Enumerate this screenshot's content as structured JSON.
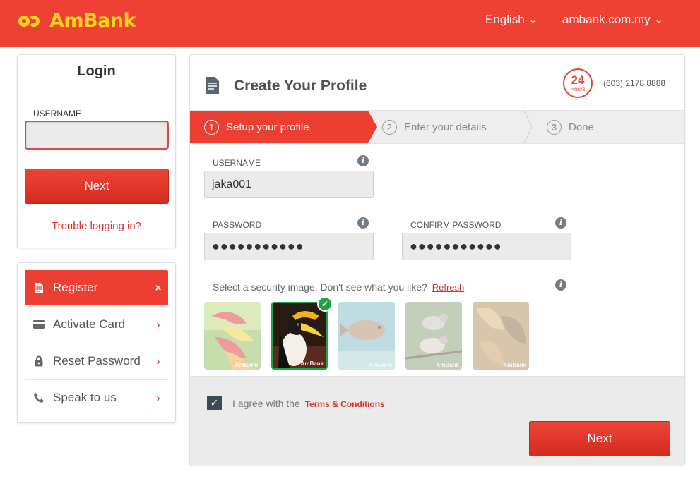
{
  "header": {
    "brand": "AmBank",
    "language": "English",
    "site": "ambank.com.my"
  },
  "login": {
    "title": "Login",
    "username_label": "USERNAME",
    "username_value": "",
    "next_label": "Next",
    "trouble_label": "Trouble logging in?"
  },
  "menu": {
    "items": [
      {
        "label": "Register",
        "icon": "document-icon",
        "action": "×",
        "active": true
      },
      {
        "label": "Activate Card",
        "icon": "card-icon",
        "action": "›",
        "active": false
      },
      {
        "label": "Reset Password",
        "icon": "lock-icon",
        "action": "›",
        "active": false
      },
      {
        "label": "Speak to us",
        "icon": "phone-icon",
        "action": "›",
        "active": false
      }
    ]
  },
  "profile": {
    "title": "Create Your Profile",
    "hotline_badge": {
      "number": "24",
      "text": "Hours"
    },
    "phone": "(603) 2178 8888",
    "steps": [
      {
        "num": "1",
        "label": "Setup your profile",
        "active": true
      },
      {
        "num": "2",
        "label": "Enter your details",
        "active": false
      },
      {
        "num": "3",
        "label": "Done",
        "active": false
      }
    ],
    "username_label": "USERNAME",
    "username_value": "jaka001",
    "password_label": "PASSWORD",
    "password_value": "●●●●●●●●●●●",
    "confirm_label": "CONFIRM PASSWORD",
    "confirm_value": "●●●●●●●●●●●",
    "security_text": "Select a security image. Don't see what you like?",
    "refresh_label": "Refresh",
    "image_watermark": "AmBank",
    "security_images": [
      {
        "name": "heliconia-flower",
        "selected": false
      },
      {
        "name": "hornbill-bird",
        "selected": true
      },
      {
        "name": "reef-fish",
        "selected": false
      },
      {
        "name": "green-pigeons",
        "selected": false
      },
      {
        "name": "dry-leaves",
        "selected": false
      }
    ],
    "agree_text": "I agree with the",
    "terms_label": "Terms & Conditions",
    "terms_checked": true,
    "next_label": "Next"
  },
  "colors": {
    "brand_red": "#ee4033",
    "brand_yellow": "#ffd21e",
    "success_green": "#1fa34a"
  }
}
